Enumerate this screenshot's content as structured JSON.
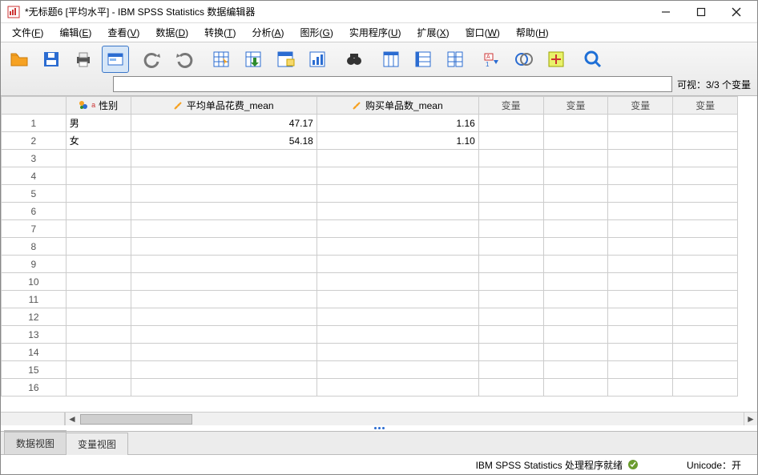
{
  "window": {
    "title": "*无标题6 [平均水平] - IBM SPSS Statistics 数据编辑器"
  },
  "menus": {
    "file": {
      "label": "文件",
      "accel": "F"
    },
    "edit": {
      "label": "编辑",
      "accel": "E"
    },
    "view": {
      "label": "查看",
      "accel": "V"
    },
    "data": {
      "label": "数据",
      "accel": "D"
    },
    "transform": {
      "label": "转换",
      "accel": "T"
    },
    "analyze": {
      "label": "分析",
      "accel": "A"
    },
    "graphs": {
      "label": "图形",
      "accel": "G"
    },
    "utilities": {
      "label": "实用程序",
      "accel": "U"
    },
    "extensions": {
      "label": "扩展",
      "accel": "X"
    },
    "window": {
      "label": "窗口",
      "accel": "W"
    },
    "help": {
      "label": "帮助",
      "accel": "H"
    }
  },
  "toolbar": {
    "visible_label": "可视：3/3 个变量"
  },
  "columns": {
    "c0": "性别",
    "c1": "平均单品花费_mean",
    "c2": "购买单品数_mean",
    "placeholder": "变量"
  },
  "rows": [
    {
      "n": "1",
      "c0": "男",
      "c1": "47.17",
      "c2": "1.16"
    },
    {
      "n": "2",
      "c0": "女",
      "c1": "54.18",
      "c2": "1.10"
    },
    {
      "n": "3",
      "c0": "",
      "c1": "",
      "c2": ""
    },
    {
      "n": "4",
      "c0": "",
      "c1": "",
      "c2": ""
    },
    {
      "n": "5",
      "c0": "",
      "c1": "",
      "c2": ""
    },
    {
      "n": "6",
      "c0": "",
      "c1": "",
      "c2": ""
    },
    {
      "n": "7",
      "c0": "",
      "c1": "",
      "c2": ""
    },
    {
      "n": "8",
      "c0": "",
      "c1": "",
      "c2": ""
    },
    {
      "n": "9",
      "c0": "",
      "c1": "",
      "c2": ""
    },
    {
      "n": "10",
      "c0": "",
      "c1": "",
      "c2": ""
    },
    {
      "n": "11",
      "c0": "",
      "c1": "",
      "c2": ""
    },
    {
      "n": "12",
      "c0": "",
      "c1": "",
      "c2": ""
    },
    {
      "n": "13",
      "c0": "",
      "c1": "",
      "c2": ""
    },
    {
      "n": "14",
      "c0": "",
      "c1": "",
      "c2": ""
    },
    {
      "n": "15",
      "c0": "",
      "c1": "",
      "c2": ""
    },
    {
      "n": "16",
      "c0": "",
      "c1": "",
      "c2": ""
    }
  ],
  "tabs": {
    "data_view": "数据视图",
    "variable_view": "变量视图"
  },
  "status": {
    "ready": "IBM SPSS Statistics 处理程序就绪",
    "unicode": "Unicode：开"
  }
}
